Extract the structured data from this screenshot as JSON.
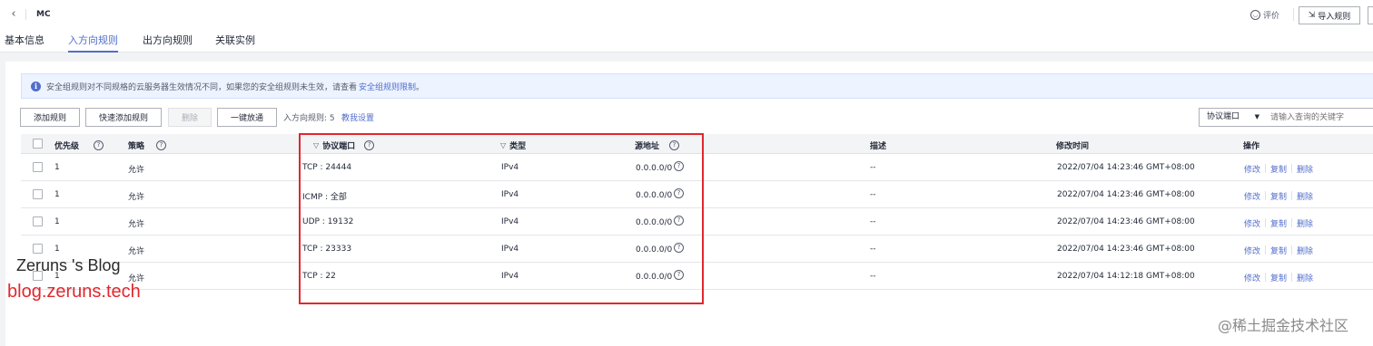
{
  "header": {
    "title": "MC",
    "rate_label": "评价",
    "import_button": "导入规则"
  },
  "tabs": [
    {
      "label": "基本信息"
    },
    {
      "label": "入方向规则"
    },
    {
      "label": "出方向规则"
    },
    {
      "label": "关联实例"
    }
  ],
  "alert": {
    "text": "安全组规则对不同规格的云服务器生效情况不同，如果您的安全组规则未生效，请查看",
    "link": "安全组规则限制",
    "suffix": "。"
  },
  "toolbar": {
    "add_rule": "添加规则",
    "quick_add": "快速添加规则",
    "delete": "删除",
    "one_click": "一键放通",
    "count_label": "入方向规则: 5",
    "help_link": "教我设置",
    "filter_select": "协议端口",
    "search_placeholder": "请输入查询的关键字"
  },
  "columns": {
    "priority": "优先级",
    "policy": "策略",
    "protocol_port": "协议端口",
    "type": "类型",
    "source": "源地址",
    "description": "描述",
    "modified": "修改时间",
    "actions": "操作"
  },
  "rows": [
    {
      "priority": "1",
      "policy": "允许",
      "protocol_port": "TCP : 24444",
      "type": "IPv4",
      "source": "0.0.0.0/0",
      "description": "--",
      "modified": "2022/07/04 14:23:46 GMT+08:00"
    },
    {
      "priority": "1",
      "policy": "允许",
      "protocol_port": "ICMP : 全部",
      "type": "IPv4",
      "source": "0.0.0.0/0",
      "description": "--",
      "modified": "2022/07/04 14:23:46 GMT+08:00"
    },
    {
      "priority": "1",
      "policy": "允许",
      "protocol_port": "UDP : 19132",
      "type": "IPv4",
      "source": "0.0.0.0/0",
      "description": "--",
      "modified": "2022/07/04 14:23:46 GMT+08:00"
    },
    {
      "priority": "1",
      "policy": "允许",
      "protocol_port": "TCP : 23333",
      "type": "IPv4",
      "source": "0.0.0.0/0",
      "description": "--",
      "modified": "2022/07/04 14:23:46 GMT+08:00"
    },
    {
      "priority": "1",
      "policy": "允许",
      "protocol_port": "TCP : 22",
      "type": "IPv4",
      "source": "0.0.0.0/0",
      "description": "--",
      "modified": "2022/07/04 14:12:18 GMT+08:00"
    }
  ],
  "row_actions": {
    "modify": "修改",
    "copy": "复制",
    "delete": "删除"
  },
  "watermarks": {
    "blog_name": "Zeruns 's Blog",
    "blog_url": "blog.zeruns.tech",
    "platform": "@稀土掘金技术社区"
  },
  "colors": {
    "accent": "#526ecc",
    "highlight_border": "#e0282e"
  }
}
